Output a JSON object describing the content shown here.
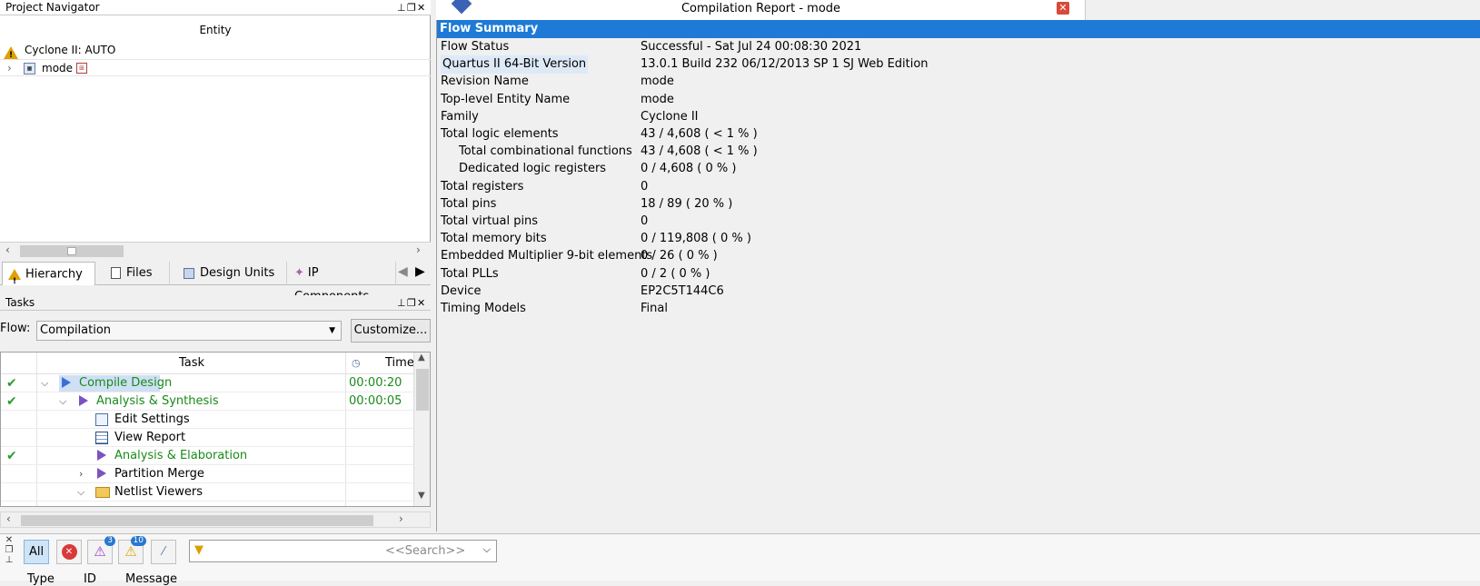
{
  "project_navigator": {
    "title": "Project Navigator",
    "column_header": "Entity",
    "device_row": "Cyclone II: AUTO",
    "entity_row": "mode",
    "tabs": [
      {
        "label": "Hierarchy",
        "icon": "warning-icon"
      },
      {
        "label": "Files",
        "icon": "files-icon"
      },
      {
        "label": "Design Units",
        "icon": "design-units-icon"
      },
      {
        "label": "IP Components",
        "icon": "ip-components-icon"
      }
    ]
  },
  "tasks": {
    "title": "Tasks",
    "flow_label": "Flow:",
    "flow_value": "Compilation",
    "customize_label": "Customize...",
    "col_task": "Task",
    "col_time": "Time",
    "rows": [
      {
        "label": "Compile Design",
        "time": "00:00:20",
        "checked": true
      },
      {
        "label": "Analysis & Synthesis",
        "time": "00:00:05",
        "checked": true
      },
      {
        "label": "Edit Settings",
        "time": "",
        "checked": false
      },
      {
        "label": "View Report",
        "time": "",
        "checked": false
      },
      {
        "label": "Analysis & Elaboration",
        "time": "",
        "checked": true
      },
      {
        "label": "Partition Merge",
        "time": "",
        "checked": false
      },
      {
        "label": "Netlist Viewers",
        "time": "",
        "checked": false
      }
    ]
  },
  "report": {
    "title": "Compilation Report - mode",
    "section": "Flow Summary",
    "rows": [
      {
        "key": "Flow Status",
        "value": "Successful - Sat Jul 24 00:08:30 2021"
      },
      {
        "key": "Quartus II 64-Bit Version",
        "value": "13.0.1 Build 232 06/12/2013 SP 1 SJ Web Edition"
      },
      {
        "key": "Revision Name",
        "value": "mode"
      },
      {
        "key": "Top-level Entity Name",
        "value": "mode"
      },
      {
        "key": "Family",
        "value": "Cyclone II"
      },
      {
        "key": "Total logic elements",
        "value": "43 / 4,608 ( < 1 % )"
      },
      {
        "key": "Total combinational functions",
        "value": "43 / 4,608 ( < 1 % )"
      },
      {
        "key": "Dedicated logic registers",
        "value": "0 / 4,608 ( 0 % )"
      },
      {
        "key": "Total registers",
        "value": "0"
      },
      {
        "key": "Total pins",
        "value": "18 / 89 ( 20 % )"
      },
      {
        "key": "Total virtual pins",
        "value": "0"
      },
      {
        "key": "Total memory bits",
        "value": "0 / 119,808 ( 0 % )"
      },
      {
        "key": "Embedded Multiplier 9-bit elements",
        "value": "0 / 26 ( 0 % )"
      },
      {
        "key": "Total PLLs",
        "value": "0 / 2 ( 0 % )"
      },
      {
        "key": "Device",
        "value": "EP2C5T144C6"
      },
      {
        "key": "Timing Models",
        "value": "Final"
      }
    ]
  },
  "messages": {
    "all_label": "All",
    "critical_count": "3",
    "warning_count": "10",
    "search_placeholder": "<<Search>>",
    "col_type": "Type",
    "col_id": "ID",
    "col_message": "Message"
  }
}
